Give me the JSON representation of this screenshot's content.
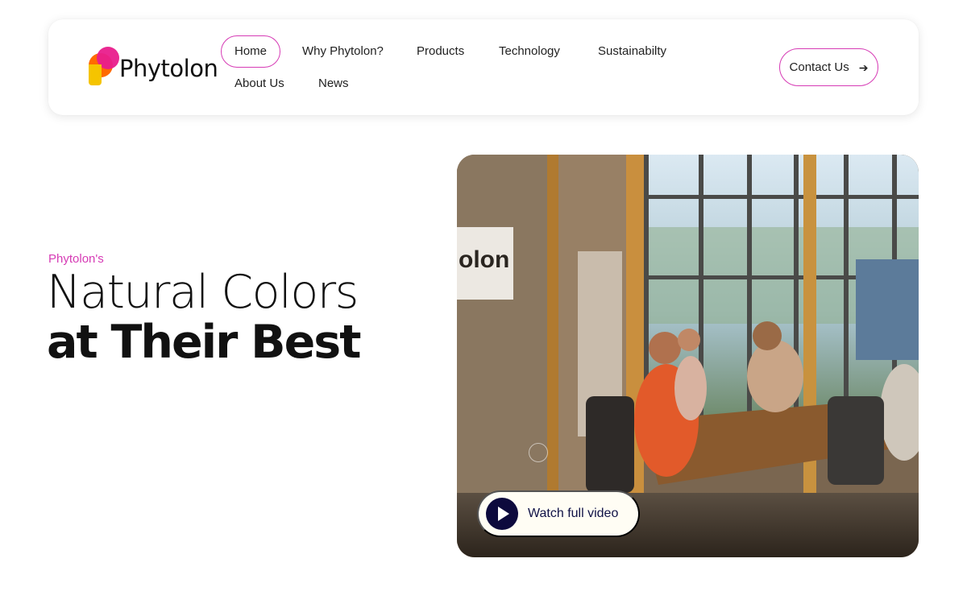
{
  "header": {
    "logo_text": "Phytolon",
    "nav": [
      {
        "label": "Home",
        "active": true
      },
      {
        "label": "Why Phytolon?",
        "active": false
      },
      {
        "label": "Products",
        "active": false
      },
      {
        "label": "Technology",
        "active": false
      },
      {
        "label": "Sustainabilty",
        "active": false
      },
      {
        "label": "About Us",
        "active": false
      },
      {
        "label": "News",
        "active": false
      }
    ],
    "contact_label": "Contact Us",
    "contact_icon": "arrow-right-icon"
  },
  "hero": {
    "eyebrow": "Phytolon's",
    "headline_line1": "Natural Colors",
    "headline_line2": "at Their Best",
    "video": {
      "watch_label": "Watch full video",
      "play_icon": "play-icon",
      "sign_text": "olon"
    }
  },
  "colors": {
    "accent": "#d63bb5",
    "play_button": "#0d0a3d",
    "watch_button_bg": "#fffdf4"
  }
}
